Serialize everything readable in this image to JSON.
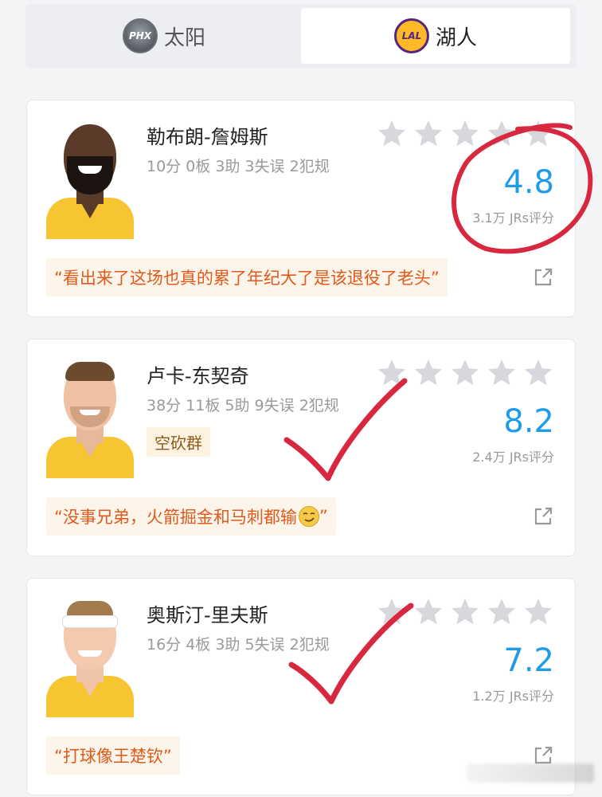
{
  "tabs": [
    {
      "logo_text": "PHX",
      "label": "太阳",
      "selected": false
    },
    {
      "logo_text": "LAL",
      "label": "湖人",
      "selected": true
    }
  ],
  "players": [
    {
      "name": "勒布朗-詹姆斯",
      "stats": "10分 0板 3助 3失误 2犯规",
      "tag": "",
      "score": "4.8",
      "votes": "3.1万 JRs评分",
      "comment": "“看出来了这场也真的累了年纪大了是该退役了老头”",
      "comment_emoji": false
    },
    {
      "name": "卢卡-东契奇",
      "stats": "38分 11板 5助 9失误 2犯规",
      "tag": "空砍群",
      "score": "8.2",
      "votes": "2.4万 JRs评分",
      "comment": "“没事兄弟，火箭掘金和马刺都输",
      "comment_end": "”",
      "comment_emoji": true
    },
    {
      "name": "奥斯汀-里夫斯",
      "stats": "16分 4板 3助 5失误 2犯规",
      "tag": "",
      "score": "7.2",
      "votes": "1.2万 JRs评分",
      "comment": "“打球像王楚钦”",
      "comment_emoji": false
    }
  ],
  "icons": {
    "star": "star-icon",
    "share": "share-icon"
  },
  "colors": {
    "accent": "#1e9ce8",
    "comment": "#e05a1c",
    "annotation": "#d8283f",
    "star": "#d6d8dd"
  }
}
